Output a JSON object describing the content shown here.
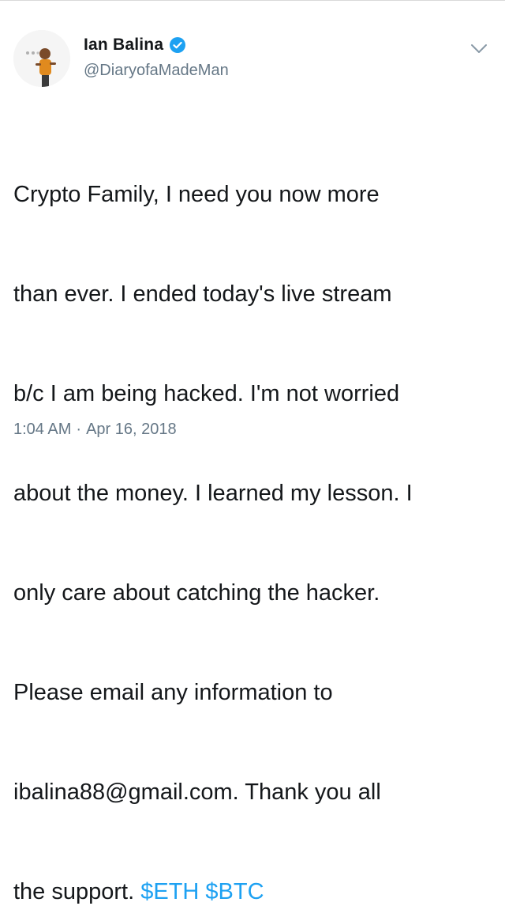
{
  "tweet": {
    "author": {
      "display_name": "Ian Balina",
      "handle": "@DiaryofaMadeMan",
      "verified": true
    },
    "text_lines": [
      "Crypto Family, I need you now more",
      "than ever. I ended today's live stream",
      "b/c I am being hacked. I'm not worried",
      "about the money. I learned my lesson. I",
      "only care about catching the hacker.",
      "Please email any information to",
      "ibalina88@gmail.com. Thank you all",
      "the support. "
    ],
    "cashtags": [
      "$ETH",
      "$BTC"
    ],
    "timestamp_time": "1:04 AM",
    "timestamp_separator": "·",
    "timestamp_date": "Apr 16, 2018"
  },
  "colors": {
    "accent": "#1da1f2",
    "secondary_text": "#657786",
    "primary_text": "#14171a"
  },
  "icons": {
    "verified": "verified-badge-icon",
    "menu": "chevron-down-icon",
    "avatar": "avatar"
  }
}
